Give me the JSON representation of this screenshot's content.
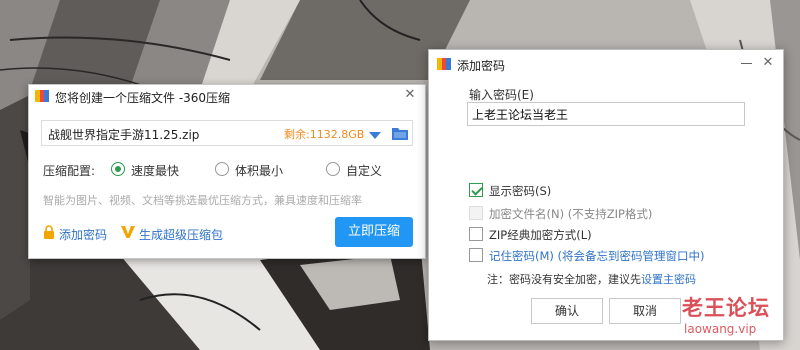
{
  "compress_dialog": {
    "title": "您将创建一个压缩文件 -360压缩",
    "close_glyph": "✕",
    "file_name": "战舰世界指定手游11.25.zip",
    "free_space": "剩余:1132.8GB",
    "config_label": "压缩配置:",
    "options": [
      {
        "label": "速度最快",
        "selected": true
      },
      {
        "label": "体积最小",
        "selected": false
      },
      {
        "label": "自定义",
        "selected": false
      }
    ],
    "hint": "智能为图片、视频、文档等挑选最优压缩方式，兼具速度和压缩率",
    "add_password": "添加密码",
    "super_package": "生成超级压缩包",
    "compress_now": "立即压缩"
  },
  "password_dialog": {
    "title": "添加密码",
    "close_glyph": "✕",
    "input_label": "输入密码(E)",
    "input_value": "上老王论坛当老王",
    "options": [
      {
        "label": "显示密码(S)",
        "checked": true,
        "disabled": false,
        "style": "normal"
      },
      {
        "label": "加密文件名(N) (不支持ZIP格式)",
        "checked": false,
        "disabled": true,
        "style": "normal"
      },
      {
        "label": "ZIP经典加密方式(L)",
        "checked": false,
        "disabled": false,
        "style": "normal"
      },
      {
        "label": "记住密码(M) (将会备忘到密码管理窗口中)",
        "checked": false,
        "disabled": false,
        "style": "link"
      }
    ],
    "note_prefix": "注：密码没有安全加密，建议先",
    "note_link": "设置主密码",
    "ok": "确认",
    "cancel": "取消"
  },
  "watermark": {
    "name": "老王论坛",
    "url": "laowang.vip"
  },
  "colors": {
    "primary_button": "#2196f3",
    "link": "#2f73c9",
    "accent_green": "#2e9b4e",
    "free_space": "#f08a1e",
    "watermark": "#d63c46"
  }
}
